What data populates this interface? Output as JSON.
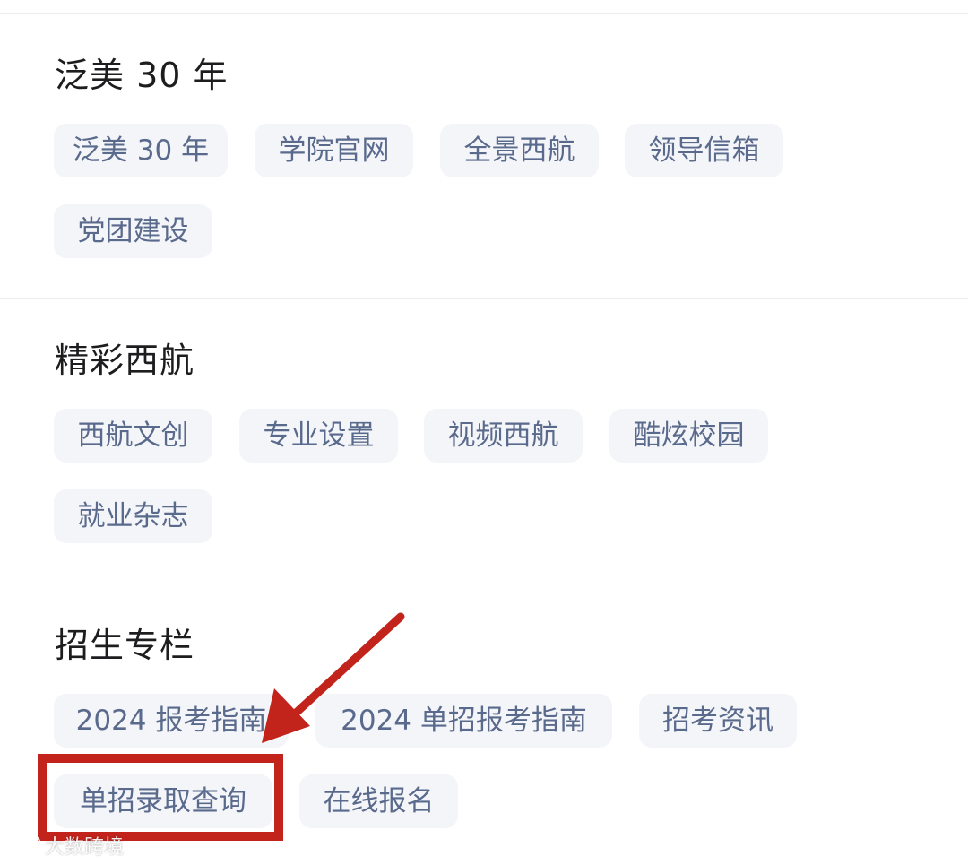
{
  "sections": [
    {
      "title": "泛美 30 年",
      "items": [
        "泛美 30 年",
        "学院官网",
        "全景西航",
        "领导信箱",
        "党团建设"
      ]
    },
    {
      "title": "精彩西航",
      "items": [
        "西航文创",
        "专业设置",
        "视频西航",
        "酷炫校园",
        "就业杂志"
      ]
    },
    {
      "title": "招生专栏",
      "items": [
        "2024 报考指南",
        "2024 单招报考指南",
        "招考资讯",
        "单招录取查询",
        "在线报名"
      ]
    }
  ],
  "annotation": {
    "highlighted_item": "单招录取查询",
    "color": "#c2241b"
  },
  "watermark": {
    "text": "大数跨境",
    "icon": "weibo-logo-icon"
  },
  "colors": {
    "chip_bg": "#f4f5f8",
    "chip_text": "#5a6a8c",
    "divider": "#ececec"
  }
}
